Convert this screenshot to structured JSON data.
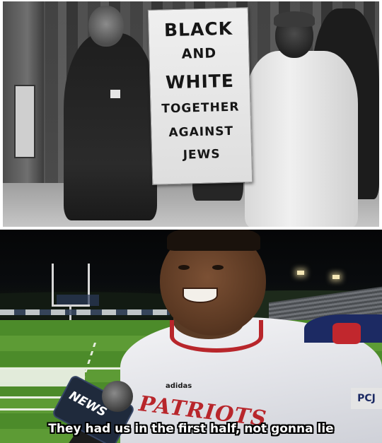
{
  "top_photo": {
    "placard": {
      "lines": [
        "BLACK",
        "AND",
        "WHITE",
        "TOGETHER",
        "AGAINST",
        "JEWS"
      ]
    }
  },
  "bottom_photo": {
    "microphone_flag": "NEWS",
    "jersey_brand": "adidas",
    "jersey_chest_text": "PATRIOTS",
    "sleeve_patch": "PCJ",
    "caption": "They had us in the first half, not gonna lie"
  }
}
